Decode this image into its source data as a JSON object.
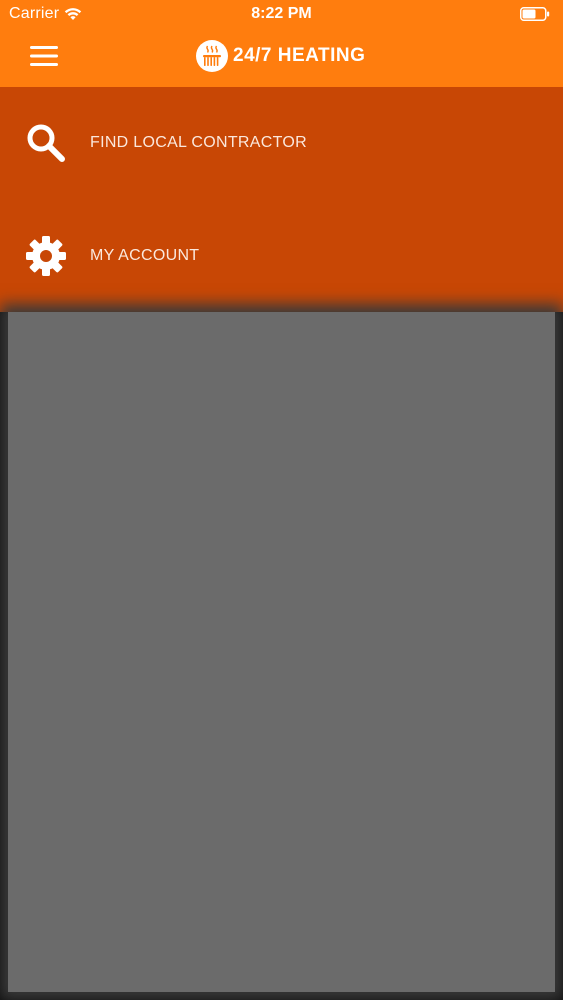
{
  "status_bar": {
    "carrier": "Carrier",
    "time": "8:22 PM",
    "wifi_icon": "wifi-icon",
    "battery_icon": "battery-icon"
  },
  "header": {
    "menu_icon": "hamburger-menu-icon",
    "brand_logo": "radiator-logo-icon",
    "brand_title": "24/7 HEATING",
    "background_color": "#ff7d0e"
  },
  "menu": {
    "background_color": "#c84705",
    "items": [
      {
        "label": "FIND LOCAL CONTRACTOR",
        "icon": "search-icon"
      },
      {
        "label": "MY ACCOUNT",
        "icon": "gear-icon"
      }
    ]
  },
  "overlay": {
    "color": "#6b6b6b"
  }
}
